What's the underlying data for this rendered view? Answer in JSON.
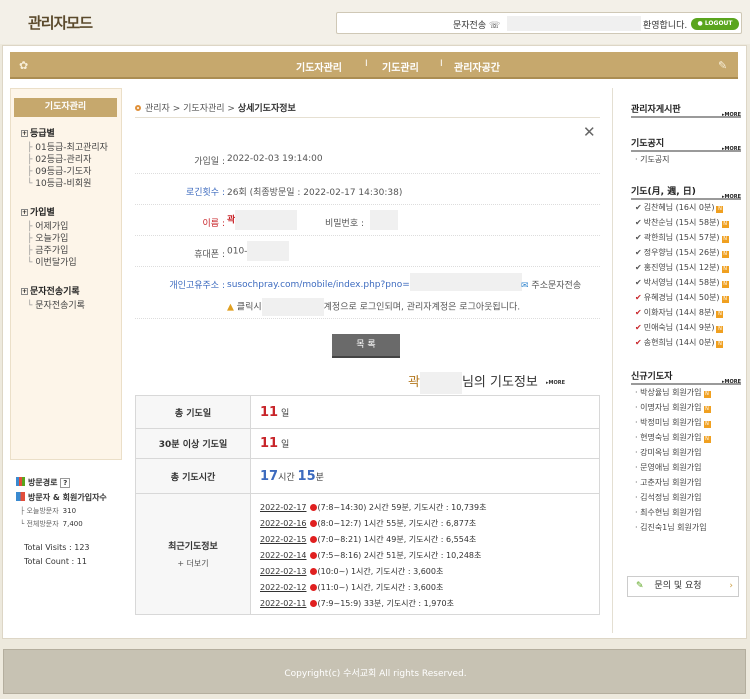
{
  "header": {
    "logo": "관리자모드",
    "sms_label": "문자전송",
    "welcome": "환영합니다.",
    "logout": "LOGOUT"
  },
  "nav": {
    "items": [
      "기도자관리",
      "기도관리",
      "관리자공간"
    ],
    "separator": "I"
  },
  "sidebar": {
    "title": "기도자관리",
    "groups": [
      {
        "label": "등급별",
        "items": [
          "01등급-최고관리자",
          "02등급-관리자",
          "09등급-기도자",
          "10등급-비회원"
        ]
      },
      {
        "label": "가입별",
        "items": [
          "어제가입",
          "오늘가입",
          "금주가입",
          "이번달가입"
        ]
      },
      {
        "label": "문자전송기록",
        "items": [
          "문자전송기록"
        ]
      }
    ],
    "stats": {
      "visit_path": "방문경로",
      "help": "?",
      "visitors_title": "방문자 & 회원가입자수",
      "today_label": "오늘방문자",
      "today_value": "310",
      "total_label": "전체방문자",
      "total_value": "7,400",
      "total_visits": "Total Visits : 123",
      "total_count": "Total Count : 11"
    }
  },
  "breadcrumb": {
    "items": [
      "관리자",
      "기도자관리"
    ],
    "current": "상세기도자정보",
    "sep": ">"
  },
  "detail": {
    "join_label": "가입일",
    "join_value": "2022-02-03 19:14:00",
    "login_label": "로긴횟수",
    "login_value": "26회 (최종방문일 : 2022-02-17 14:30:38)",
    "name_label": "이름",
    "name_value": "곽",
    "password_label": "비밀번호",
    "phone_label": "휴대폰",
    "phone_value": "010-",
    "url_label": "개인고유주소",
    "url_value": "susochpray.com/mobile/index.php?pno=",
    "sms_send": "주소문자전송",
    "warn_prefix": "클릭시",
    "warn_suffix": "계정으로 로그인되며, 관리자계정은 로그아웃됩니다.",
    "colon": ":"
  },
  "list_button": "목 록",
  "prayer": {
    "name": "곽",
    "title_suffix": "님의 기도정보",
    "more": "MORE",
    "total_days_label": "총 기도일",
    "total_days_value": "11",
    "day_unit": "일",
    "over30_label": "30분 이상 기도일",
    "over30_value": "11",
    "total_time_label": "총 기도시간",
    "hours_value": "17",
    "hours_unit": "시간",
    "minutes_value": "15",
    "minutes_unit": "분",
    "recent_label": "최근기도정보",
    "more_view": "+ 더보기",
    "records": [
      {
        "date": "2022-02-17",
        "info": "(7:8~14:30)  2시간 59분, 기도시간 : 10,739초"
      },
      {
        "date": "2022-02-16",
        "info": "(8:0~12:7)  1시간 55분, 기도시간 : 6,877초"
      },
      {
        "date": "2022-02-15",
        "info": "(7:0~8:21)  1시간 49분, 기도시간 : 6,554초"
      },
      {
        "date": "2022-02-14",
        "info": "(7:5~8:16)  2시간 51분, 기도시간 : 10,248초"
      },
      {
        "date": "2022-02-13",
        "info": "(10:0~)  1시간, 기도시간 : 3,600초"
      },
      {
        "date": "2022-02-12",
        "info": "(11:0~)  1시간, 기도시간 : 3,600초"
      },
      {
        "date": "2022-02-11",
        "info": "(7:9~15:9)   33분, 기도시간 : 1,970초"
      }
    ]
  },
  "right": {
    "board_title": "관리자게시판",
    "notice_title": "기도공지",
    "notice_items": [
      "기도공지"
    ],
    "prayer_title": "기도(月, 週, 日)",
    "prayer_items": [
      {
        "text": "김찬혜님 (16시 0분)",
        "red": false
      },
      {
        "text": "박찬순님 (15시 58분)",
        "red": false
      },
      {
        "text": "곽한희님 (15시 57분)",
        "red": false
      },
      {
        "text": "정우향님 (15시 26분)",
        "red": false
      },
      {
        "text": "홍진영님 (15시 12분)",
        "red": false
      },
      {
        "text": "박서영님 (14시 58분)",
        "red": false
      },
      {
        "text": "유혜경님 (14시 50분)",
        "red": true
      },
      {
        "text": "이화자님 (14시 8분)",
        "red": true
      },
      {
        "text": "민애숙님 (14시 9분)",
        "red": true
      },
      {
        "text": "송현희님 (14시 0분)",
        "red": true
      }
    ],
    "new_title": "신규기도자",
    "new_items": [
      {
        "text": "박상율님 회원가입",
        "badge": true
      },
      {
        "text": "이명자님 회원가입",
        "badge": true
      },
      {
        "text": "박정미님 회원가입",
        "badge": true
      },
      {
        "text": "현명숙님 회원가입",
        "badge": true
      },
      {
        "text": "강미옥님 회원가입",
        "badge": false
      },
      {
        "text": "문영애님 회원가입",
        "badge": false
      },
      {
        "text": "고춘자님 회원가입",
        "badge": false
      },
      {
        "text": "김석정님 회원가입",
        "badge": false
      },
      {
        "text": "최수현님 회원가입",
        "badge": false
      },
      {
        "text": "김진숙1님 회원가입",
        "badge": false
      }
    ],
    "more": "MORE",
    "new_badge": "N",
    "inquiry": "문의 및 요청"
  },
  "footer": {
    "text": "Copyright(c) 수서교회 All rights Reserved."
  },
  "colors": {
    "accent": "#c6a86d",
    "red": "#c8252a",
    "blue": "#3d6bbf"
  }
}
